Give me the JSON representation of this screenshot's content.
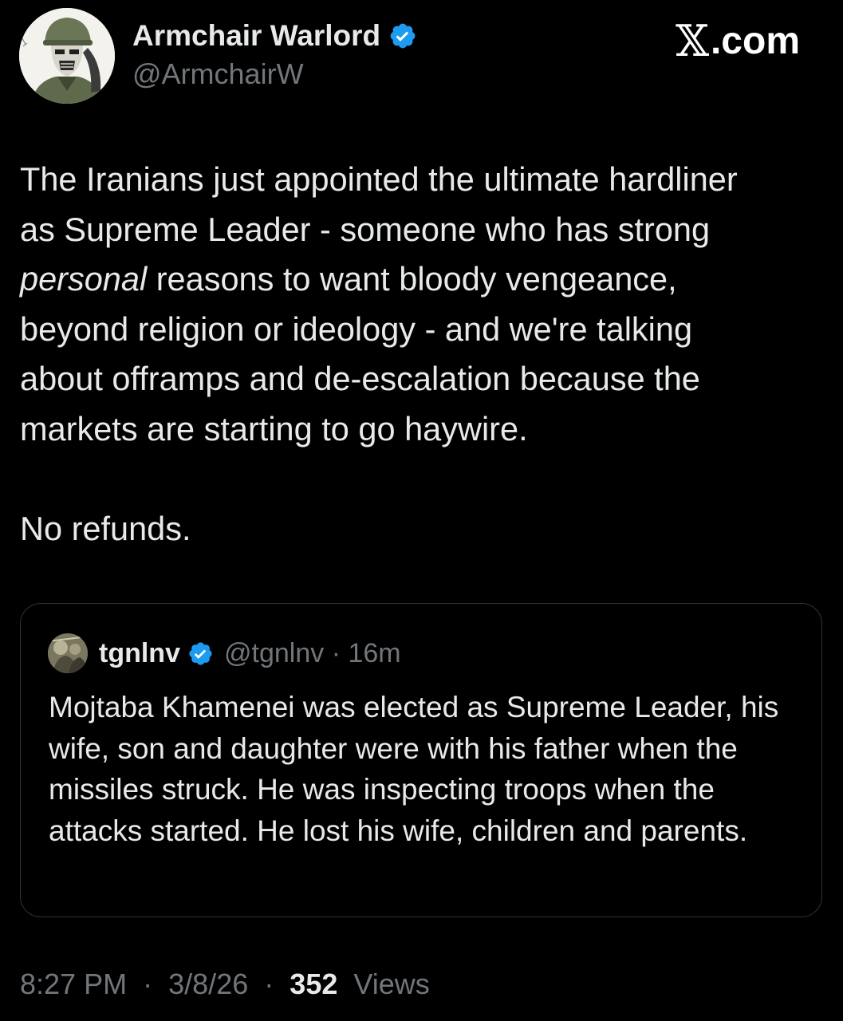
{
  "site": {
    "logo_glyph": "𝕏",
    "logo_text": ".com"
  },
  "author": {
    "name": "Armchair Warlord",
    "handle": "@ArmchairW",
    "verified_color": "#1d9bf0",
    "avatar_icon": "soldier-avatar"
  },
  "tweet": {
    "line1": "The Iranians just appointed the ultimate hardliner",
    "line2": "as Supreme Leader - someone who has strong",
    "line3_italic": "personal",
    "line3_rest": " reasons to want bloody vengeance,",
    "line4": "beyond religion or ideology - and we're talking",
    "line5": "about offramps and de-escalation because the",
    "line6": "markets are starting to go haywire.",
    "line7": "No refunds."
  },
  "quote": {
    "name": "tgnlnv",
    "handle": "@tgnlnv",
    "separator": "·",
    "time_ago": "16m",
    "avatar_icon": "quote-avatar",
    "text": "Mojtaba Khamenei was elected as Supreme Leader, his wife, son and daughter were with his father when the missiles struck. He was inspecting troops when the attacks started. He lost his wife, children and parents."
  },
  "footer": {
    "time": "8:27 PM",
    "separator1": "·",
    "date": "3/8/26",
    "separator2": "·",
    "views_count": "352",
    "views_label": "Views"
  },
  "colors": {
    "background": "#000000",
    "text_primary": "#e7e9ea",
    "text_secondary": "#71767b",
    "border": "#2f3336"
  }
}
